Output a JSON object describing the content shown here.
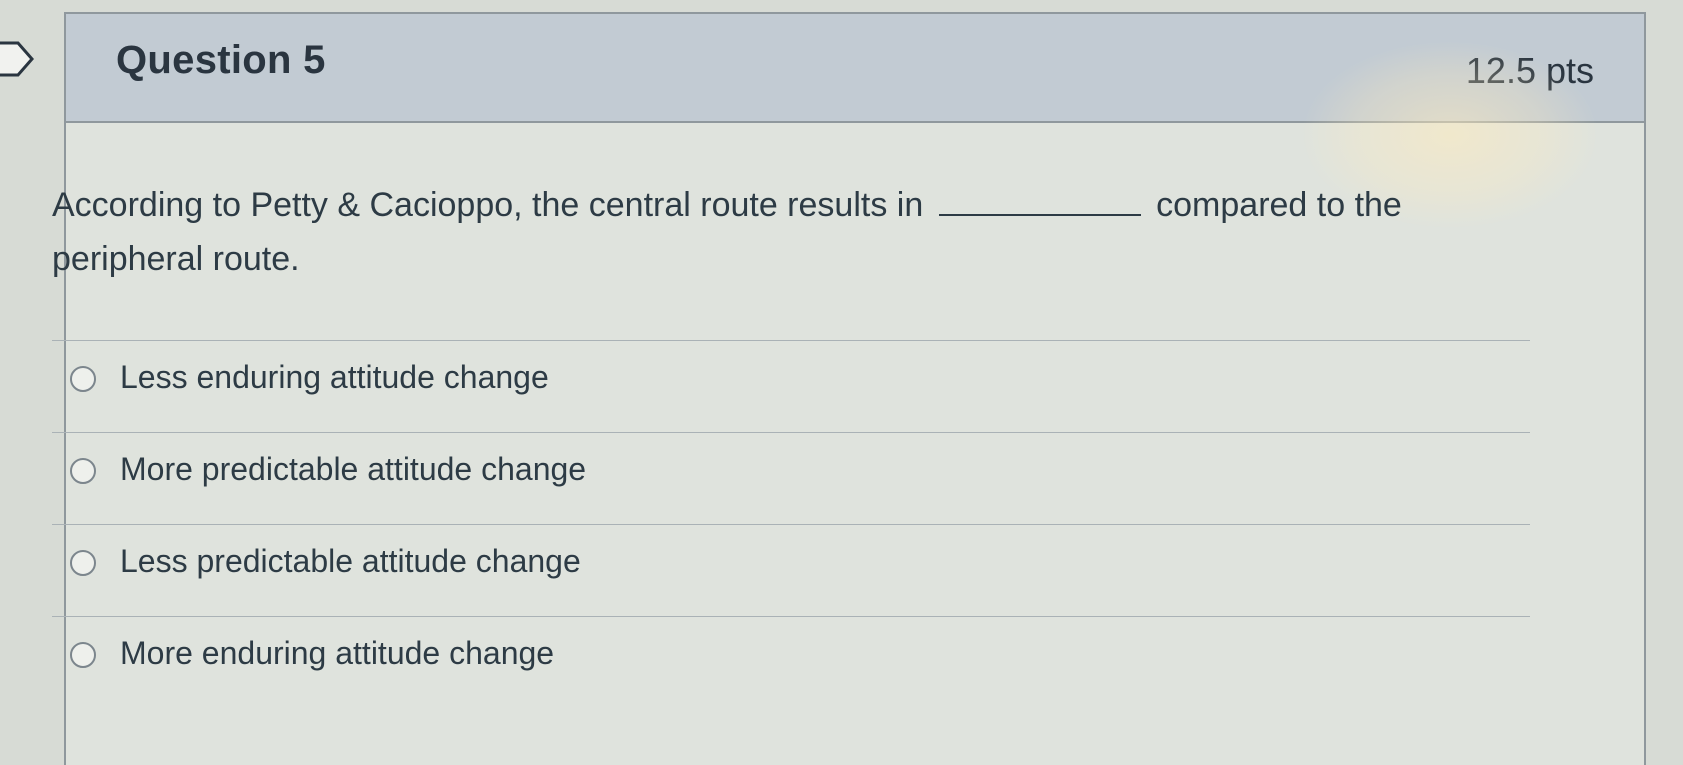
{
  "question": {
    "title": "Question 5",
    "points": "12.5 pts",
    "text_before_blank": "According to Petty & Cacioppo, the central route results in",
    "text_after_blank": "compared to the peripheral route."
  },
  "answers": [
    {
      "label": "Less enduring attitude change"
    },
    {
      "label": "More predictable attitude change"
    },
    {
      "label": "Less predictable attitude change"
    },
    {
      "label": "More enduring attitude change"
    }
  ],
  "colors": {
    "header_bg": "#c2cbd3",
    "card_bg": "#dfe3dd",
    "text": "#2d3b45",
    "border": "#8f989d"
  },
  "icons": {
    "flag": "bookmark-flag-icon",
    "radio": "radio-button-icon"
  }
}
